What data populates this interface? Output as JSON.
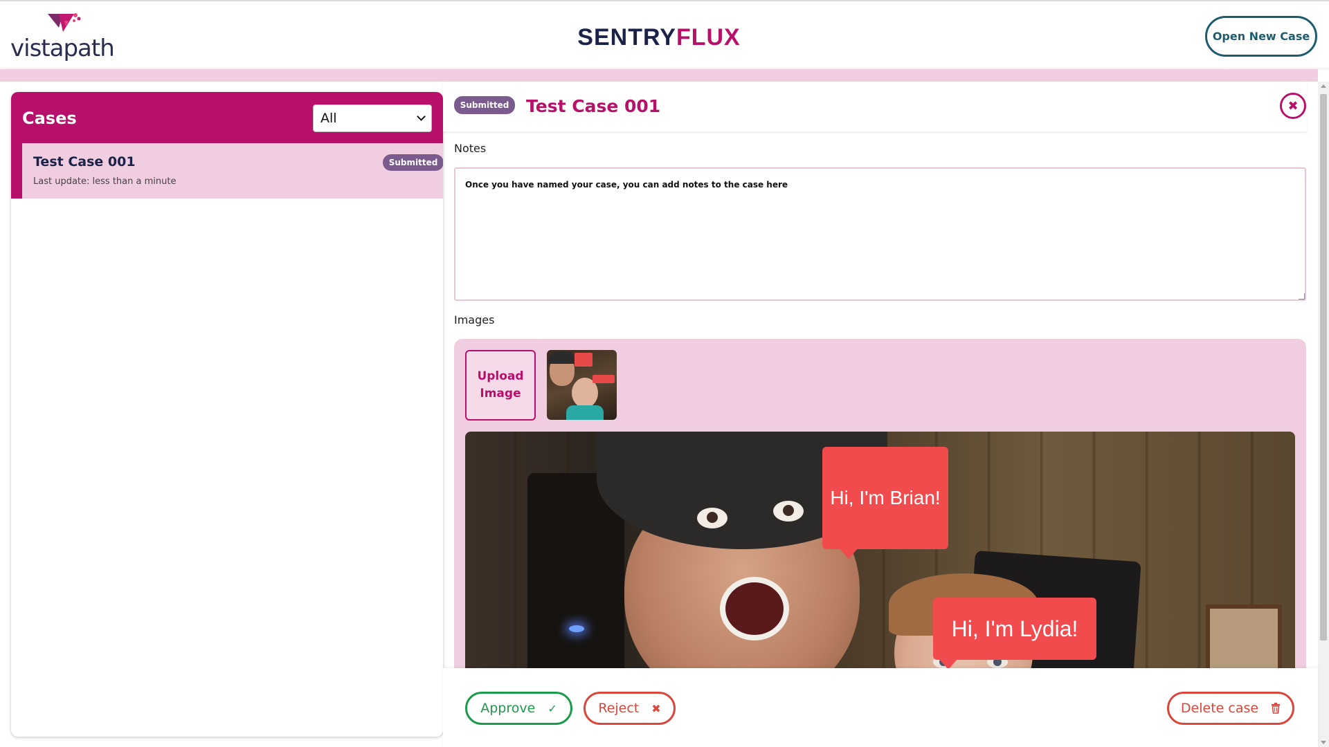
{
  "header": {
    "logo_text": "vistapath",
    "app_title_part1": "SENTRY",
    "app_title_part2": "FLUX",
    "open_case_label": "Open New Case"
  },
  "sidebar": {
    "title": "Cases",
    "filter": {
      "selected": "All"
    },
    "cases": [
      {
        "name": "Test Case 001",
        "status": "Submitted",
        "last_update": "Last update: less than a minute"
      }
    ]
  },
  "case_detail": {
    "status": "Submitted",
    "title": "Test Case 001",
    "notes_label": "Notes",
    "notes_text": "Once you have named your case, you can add notes to the case here",
    "images_label": "Images",
    "upload_label_line1": "Upload",
    "upload_label_line2": "Image",
    "image_bubbles": [
      "Hi, I'm Brian!",
      "Hi, I'm Lydia!"
    ]
  },
  "actions": {
    "approve_label": "Approve",
    "approve_icon": "✓",
    "reject_label": "Reject",
    "reject_icon": "✖",
    "delete_label": "Delete case",
    "close_icon": "✖"
  },
  "colors": {
    "brand": "#b8106a",
    "navy": "#1a2248",
    "teal": "#1d5c6e",
    "approve": "#1b9a4a",
    "reject": "#d9463b",
    "badge": "#7b5a8e",
    "pink_light": "#f0cde0"
  }
}
